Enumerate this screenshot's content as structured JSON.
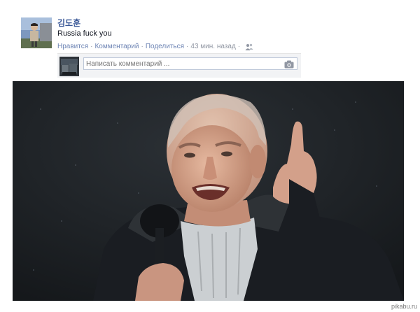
{
  "post": {
    "author": "김도훈",
    "text": "Russia fuck you",
    "actions": {
      "like": "Нравится",
      "comment": "Комментарий",
      "share": "Поделиться",
      "separator": "·",
      "time": "43 мин. назад",
      "audience_icon": "friends-icon"
    }
  },
  "comment_box": {
    "placeholder": "Написать комментарий ...",
    "camera_icon": "camera-icon"
  },
  "watermark": "pikabu.ru",
  "colors": {
    "link": "#3b5998",
    "action_link": "#6d84b4",
    "meta": "#9197a3",
    "comment_bg": "#f2f3f5"
  }
}
